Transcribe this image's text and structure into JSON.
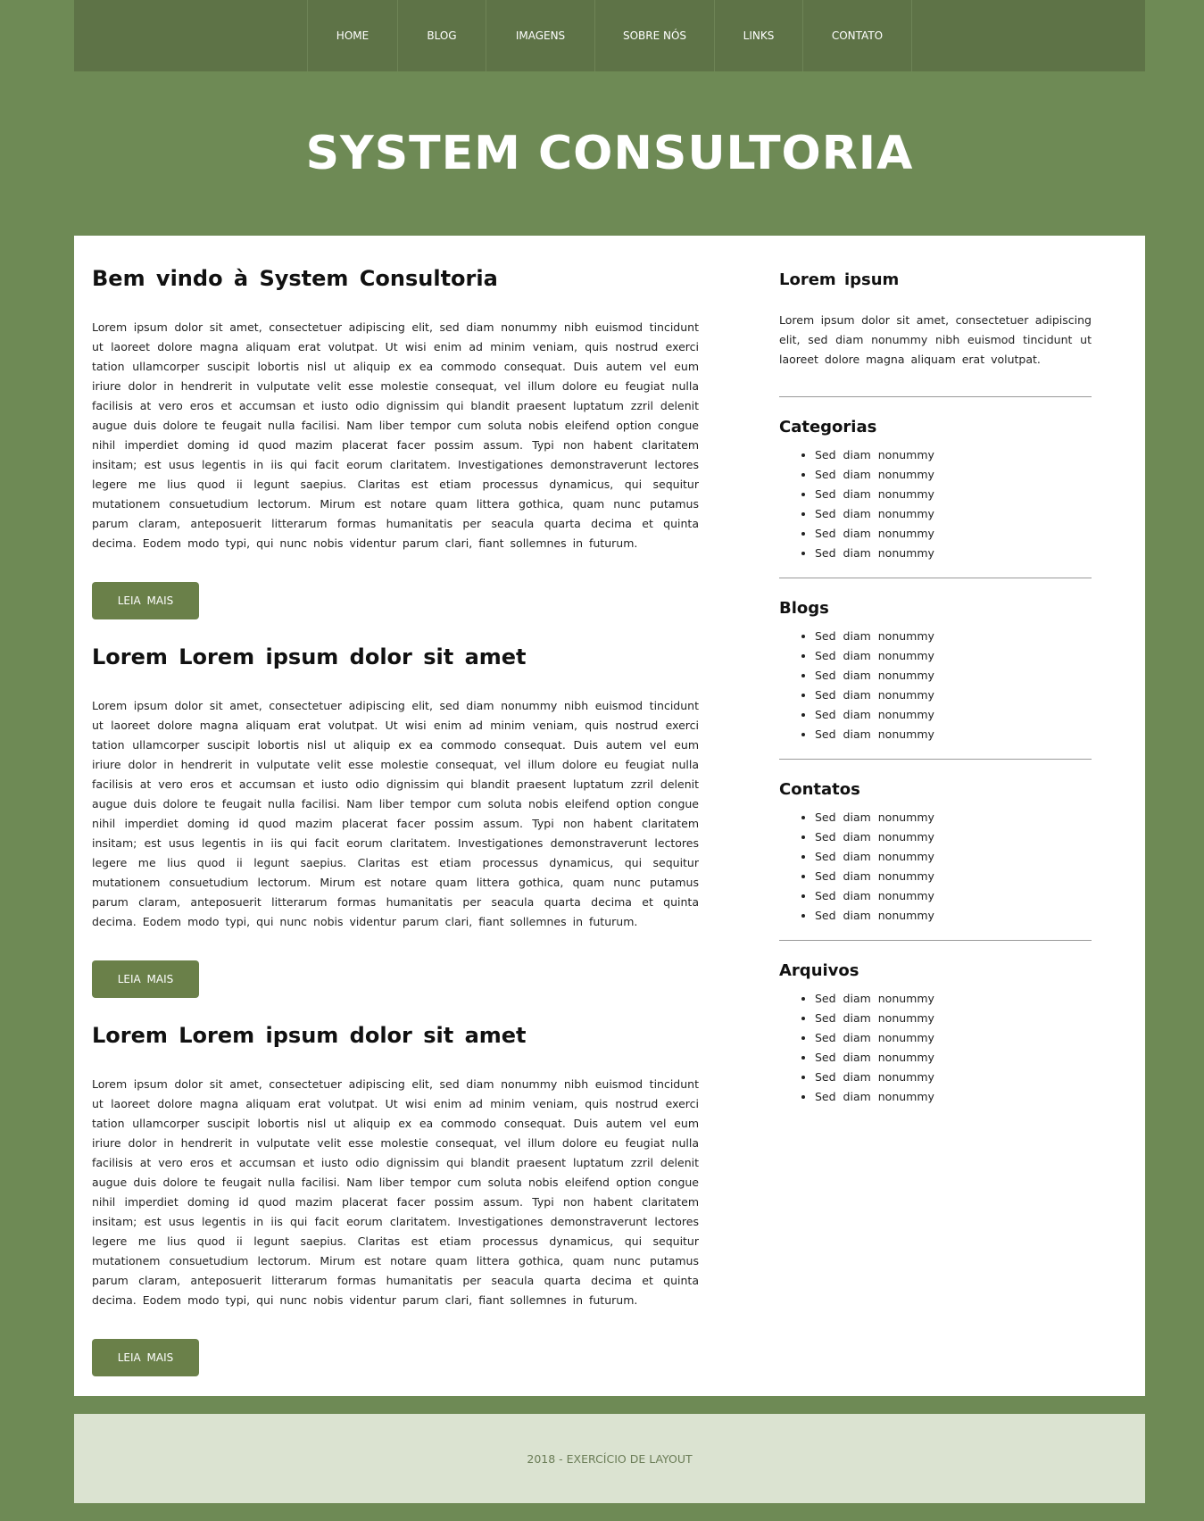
{
  "nav": {
    "items": [
      {
        "label": "HOME"
      },
      {
        "label": "BLOG"
      },
      {
        "label": "IMAGENS"
      },
      {
        "label": "SOBRE NÓS"
      },
      {
        "label": "LINKS"
      },
      {
        "label": "CONTATO"
      }
    ]
  },
  "header": {
    "title": "SYSTEM CONSULTORIA"
  },
  "articles": [
    {
      "title": "Bem vindo à System Consultoria",
      "body": "Lorem ipsum dolor sit amet, consectetuer adipiscing elit, sed diam nonummy nibh euismod tincidunt ut laoreet dolore magna aliquam erat volutpat. Ut wisi enim ad minim veniam, quis nostrud exerci tation ullamcorper suscipit lobortis nisl ut aliquip ex ea commodo consequat. Duis autem vel eum iriure dolor in hendrerit in vulputate velit esse molestie consequat, vel illum dolore eu feugiat nulla facilisis at vero eros et accumsan et iusto odio dignissim qui blandit praesent luptatum zzril delenit augue duis dolore te feugait nulla facilisi. Nam liber tempor cum soluta nobis eleifend option congue nihil imperdiet doming id quod mazim placerat facer possim assum. Typi non habent claritatem insitam; est usus legentis in iis qui facit eorum claritatem. Investigationes demonstraverunt lectores legere me lius quod ii legunt saepius. Claritas est etiam processus dynamicus, qui sequitur mutationem consuetudium lectorum. Mirum est notare quam littera gothica, quam nunc putamus parum claram, anteposuerit litterarum formas humanitatis per seacula quarta decima et quinta decima. Eodem modo typi, qui nunc nobis videntur parum clari, fiant sollemnes in futurum.",
      "button": "LEIA MAIS"
    },
    {
      "title": "Lorem Lorem ipsum dolor sit amet",
      "body": "Lorem ipsum dolor sit amet, consectetuer adipiscing elit, sed diam nonummy nibh euismod tincidunt ut laoreet dolore magna aliquam erat volutpat. Ut wisi enim ad minim veniam, quis nostrud exerci tation ullamcorper suscipit lobortis nisl ut aliquip ex ea commodo consequat. Duis autem vel eum iriure dolor in hendrerit in vulputate velit esse molestie consequat, vel illum dolore eu feugiat nulla facilisis at vero eros et accumsan et iusto odio dignissim qui blandit praesent luptatum zzril delenit augue duis dolore te feugait nulla facilisi. Nam liber tempor cum soluta nobis eleifend option congue nihil imperdiet doming id quod mazim placerat facer possim assum. Typi non habent claritatem insitam; est usus legentis in iis qui facit eorum claritatem. Investigationes demonstraverunt lectores legere me lius quod ii legunt saepius. Claritas est etiam processus dynamicus, qui sequitur mutationem consuetudium lectorum. Mirum est notare quam littera gothica, quam nunc putamus parum claram, anteposuerit litterarum formas humanitatis per seacula quarta decima et quinta decima. Eodem modo typi, qui nunc nobis videntur parum clari, fiant sollemnes in futurum.",
      "button": "LEIA MAIS"
    },
    {
      "title": "Lorem Lorem ipsum dolor sit amet",
      "body": "Lorem ipsum dolor sit amet, consectetuer adipiscing elit, sed diam nonummy nibh euismod tincidunt ut laoreet dolore magna aliquam erat volutpat. Ut wisi enim ad minim veniam, quis nostrud exerci tation ullamcorper suscipit lobortis nisl ut aliquip ex ea commodo consequat. Duis autem vel eum iriure dolor in hendrerit in vulputate velit esse molestie consequat, vel illum dolore eu feugiat nulla facilisis at vero eros et accumsan et iusto odio dignissim qui blandit praesent luptatum zzril delenit augue duis dolore te feugait nulla facilisi. Nam liber tempor cum soluta nobis eleifend option congue nihil imperdiet doming id quod mazim placerat facer possim assum. Typi non habent claritatem insitam; est usus legentis in iis qui facit eorum claritatem. Investigationes demonstraverunt lectores legere me lius quod ii legunt saepius. Claritas est etiam processus dynamicus, qui sequitur mutationem consuetudium lectorum. Mirum est notare quam littera gothica, quam nunc putamus parum claram, anteposuerit litterarum formas humanitatis per seacula quarta decima et quinta decima. Eodem modo typi, qui nunc nobis videntur parum clari, fiant sollemnes in futurum.",
      "button": "LEIA MAIS"
    }
  ],
  "sidebar": {
    "about": {
      "title": "Lorem ipsum",
      "body": "Lorem ipsum dolor sit amet, consectetuer adipiscing elit, sed diam nonummy nibh euismod tincidunt ut laoreet dolore magna aliquam erat volutpat."
    },
    "categorias": {
      "title": "Categorias",
      "items": [
        "Sed diam nonummy",
        "Sed diam nonummy",
        "Sed diam nonummy",
        "Sed diam nonummy",
        "Sed diam nonummy",
        "Sed diam nonummy"
      ]
    },
    "blogs": {
      "title": "Blogs",
      "items": [
        "Sed diam nonummy",
        "Sed diam nonummy",
        "Sed diam nonummy",
        "Sed diam nonummy",
        "Sed diam nonummy",
        "Sed diam nonummy"
      ]
    },
    "contatos": {
      "title": "Contatos",
      "items": [
        "Sed diam nonummy",
        "Sed diam nonummy",
        "Sed diam nonummy",
        "Sed diam nonummy",
        "Sed diam nonummy",
        "Sed diam nonummy"
      ]
    },
    "arquivos": {
      "title": "Arquivos",
      "items": [
        "Sed diam nonummy",
        "Sed diam nonummy",
        "Sed diam nonummy",
        "Sed diam nonummy",
        "Sed diam nonummy",
        "Sed diam nonummy"
      ]
    }
  },
  "footer": {
    "text": "2018 - EXERCÍCIO DE LAYOUT"
  },
  "colors": {
    "background": "#6e8a55",
    "nav": "#5e7347",
    "button": "#6a8049",
    "footer_bg": "#dbe3d1",
    "footer_text": "#6b7d57"
  }
}
